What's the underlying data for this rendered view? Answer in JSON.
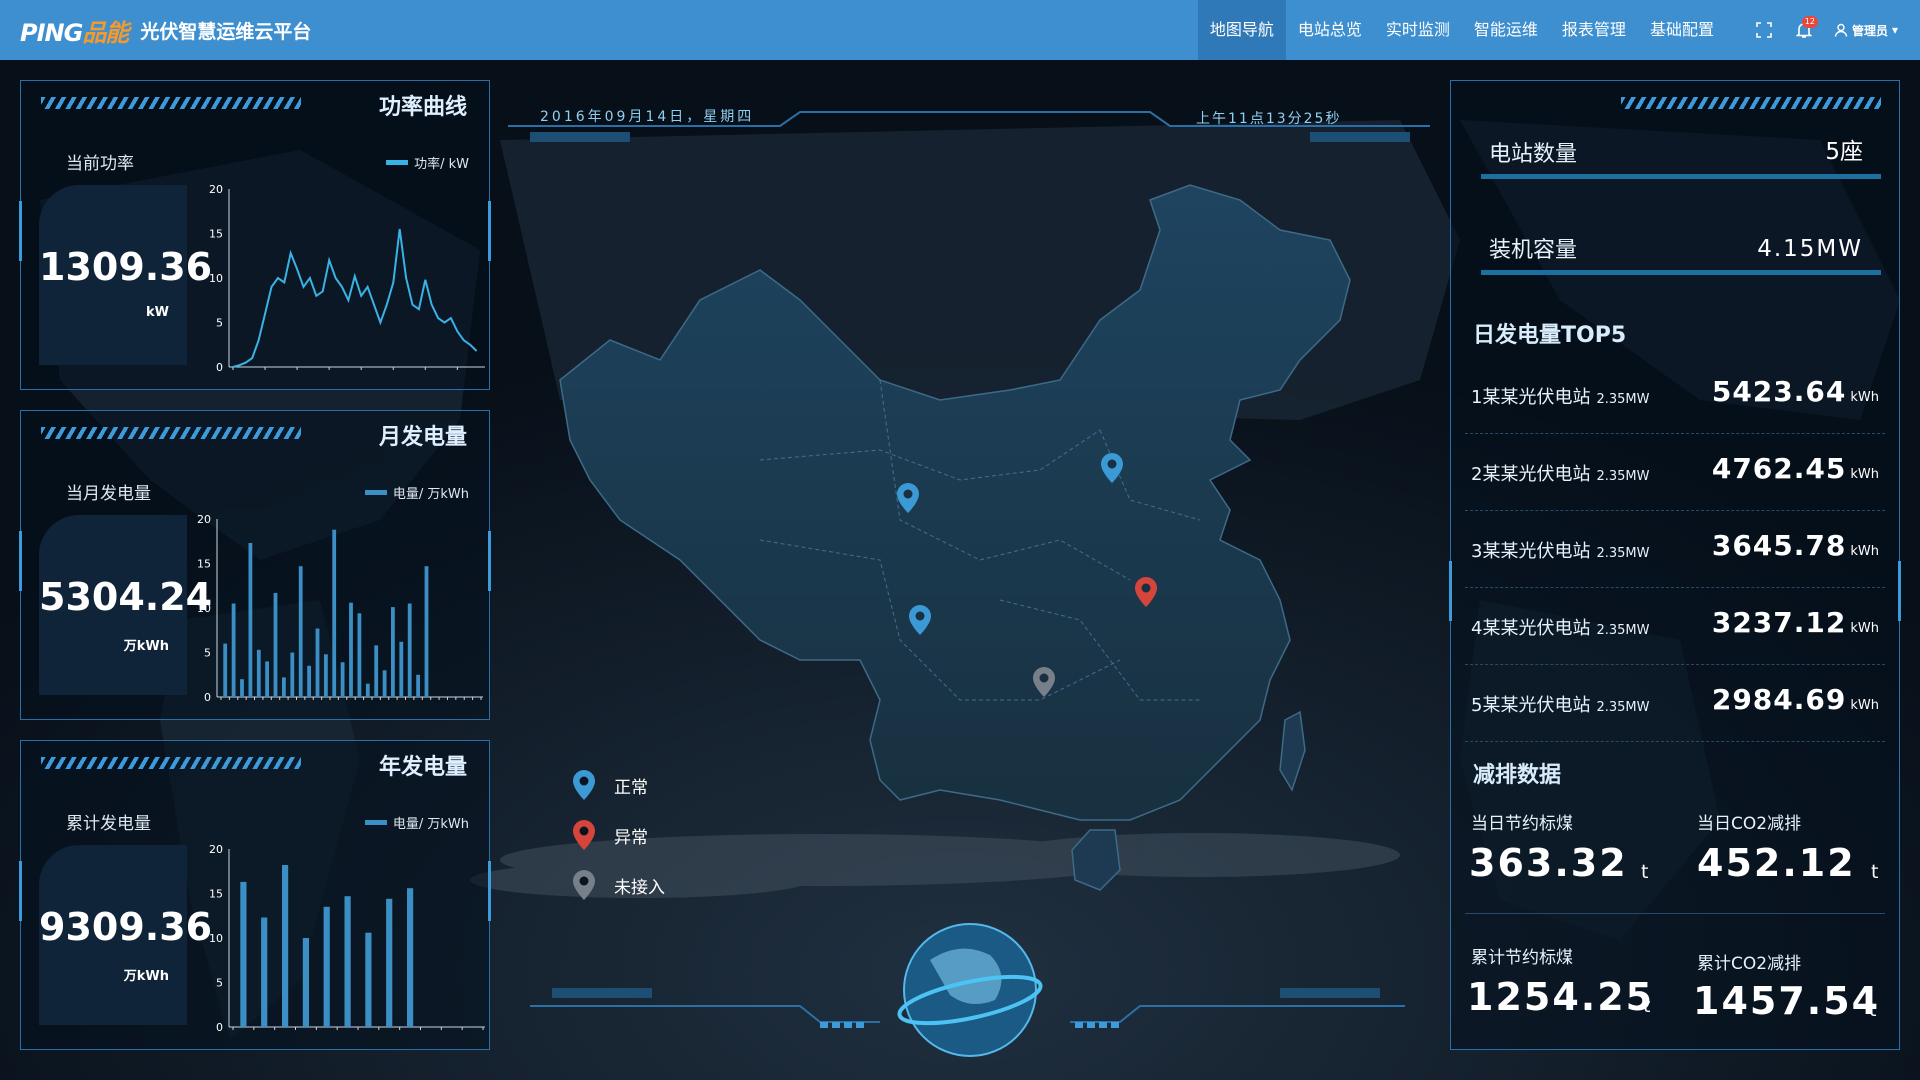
{
  "header": {
    "logo_a": "PING",
    "logo_b": "品能",
    "title": "光伏智慧运维云平台",
    "nav": [
      {
        "label": "地图导航",
        "active": true
      },
      {
        "label": "电站总览"
      },
      {
        "label": "实时监测"
      },
      {
        "label": "智能运维"
      },
      {
        "label": "报表管理"
      },
      {
        "label": "基础配置"
      }
    ],
    "fullscreen_icon": "fullscreen-icon",
    "bell_icon": "bell-icon",
    "notification_count": "12",
    "user_icon": "user-icon",
    "user_label": "管理员",
    "user_caret": "▾"
  },
  "power_panel": {
    "title": "功率曲线",
    "kpi_label": "当前功率",
    "value": "1309.36",
    "unit": "kW",
    "legend": "功率/ kW"
  },
  "month_panel": {
    "title": "月发电量",
    "kpi_label": "当月发电量",
    "value": "5304.24",
    "unit": "万kWh",
    "legend": "电量/ 万kWh"
  },
  "year_panel": {
    "title": "年发电量",
    "kpi_label": "累计发电量",
    "value": "9309.36",
    "unit": "万kWh",
    "legend": "电量/ 万kWh"
  },
  "center": {
    "date": "2016年09月14日，星期四",
    "time": "上午11点13分25秒",
    "legend": [
      {
        "label": "正常",
        "color": "#3b9ad6"
      },
      {
        "label": "异常",
        "color": "#d6453c"
      },
      {
        "label": "未接入",
        "color": "#777f88"
      }
    ],
    "markers": [
      {
        "status": "正常",
        "color": "#3b9ad6"
      },
      {
        "status": "正常",
        "color": "#3b9ad6"
      },
      {
        "status": "正常",
        "color": "#3b9ad6"
      },
      {
        "status": "异常",
        "color": "#d6453c"
      },
      {
        "status": "未接入",
        "color": "#777f88"
      }
    ]
  },
  "right": {
    "station_count_label": "电站数量",
    "station_count": "5座",
    "capacity_label": "装机容量",
    "capacity": "4.15MW",
    "top5_title": "日发电量TOP5",
    "top5": [
      {
        "name": "1某某光伏电站",
        "cap": "2.35MW",
        "value": "5423.64",
        "unit": "kWh"
      },
      {
        "name": "2某某光伏电站",
        "cap": "2.35MW",
        "value": "4762.45",
        "unit": "kWh"
      },
      {
        "name": "3某某光伏电站",
        "cap": "2.35MW",
        "value": "3645.78",
        "unit": "kWh"
      },
      {
        "name": "4某某光伏电站",
        "cap": "2.35MW",
        "value": "3237.12",
        "unit": "kWh"
      },
      {
        "name": "5某某光伏电站",
        "cap": "2.35MW",
        "value": "2984.69",
        "unit": "kWh"
      }
    ],
    "emission_title": "减排数据",
    "emissions": [
      {
        "label": "当日节约标煤",
        "value": "363.32",
        "unit": "t"
      },
      {
        "label": "当日CO2减排",
        "value": "452.12",
        "unit": "t"
      },
      {
        "label": "累计节约标煤",
        "value": "1254.25",
        "unit": "t"
      },
      {
        "label": "累计CO2减排",
        "value": "1457.54",
        "unit": "t"
      }
    ]
  },
  "chart_data": [
    {
      "type": "line",
      "name_ref": "power_panel",
      "ylim": [
        0,
        20
      ],
      "yticks": [
        0,
        5,
        10,
        15,
        20
      ],
      "color": "#39b2e6",
      "values": [
        0,
        0.2,
        0.5,
        1,
        3,
        6,
        9,
        10,
        9.5,
        12.8,
        11,
        9,
        10,
        8,
        8.5,
        12,
        10,
        9,
        7.5,
        10.2,
        8,
        9,
        7,
        5,
        7,
        9.5,
        15.5,
        10,
        7,
        6.5,
        9.8,
        7,
        5.5,
        5,
        5.5,
        4,
        3,
        2.5,
        1.8
      ]
    },
    {
      "type": "bar",
      "name_ref": "month_panel",
      "ylim": [
        0,
        20
      ],
      "yticks": [
        0,
        5,
        10,
        15,
        20
      ],
      "color": "#3b8fc4",
      "values": [
        6,
        10.5,
        2,
        17.3,
        5.3,
        4,
        11.7,
        2.2,
        5,
        14.7,
        3.5,
        7.7,
        4.8,
        18.8,
        3.9,
        10.6,
        9.4,
        1.5,
        5.8,
        3,
        10.1,
        6.2,
        10.5,
        2.5,
        14.7,
        0,
        0,
        0,
        0,
        0,
        0
      ]
    },
    {
      "type": "bar",
      "name_ref": "year_panel",
      "ylim": [
        0,
        20
      ],
      "yticks": [
        0,
        5,
        10,
        15,
        20
      ],
      "color": "#3b8fc4",
      "values": [
        16.3,
        12.3,
        18.2,
        10,
        13.5,
        14.7,
        10.6,
        14.4,
        15.6,
        0,
        0,
        0
      ]
    }
  ]
}
